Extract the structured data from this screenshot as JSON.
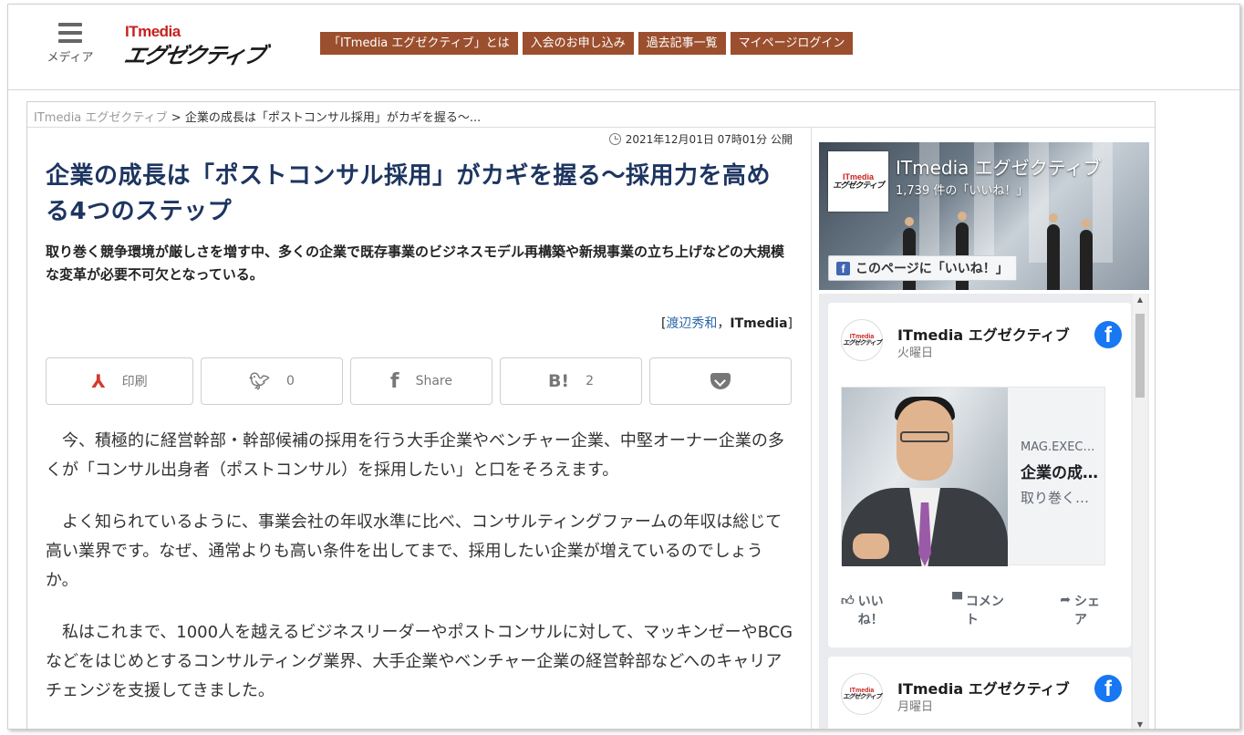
{
  "header": {
    "menu_label": "メディア",
    "logo_it": "ITmedia",
    "logo_ex": "エグゼクティブ",
    "nav": [
      {
        "label": "「ITmedia エグゼクティブ」とは"
      },
      {
        "label": "入会のお申し込み"
      },
      {
        "label": "過去記事一覧"
      },
      {
        "label": "マイページログイン"
      }
    ]
  },
  "breadcrumb": {
    "home": "ITmedia エグゼクティブ",
    "separator": ">",
    "current": "企業の成長は「ポストコンサル採用」がカギを握る～..."
  },
  "article": {
    "published": "2021年12月01日 07時01分 公開",
    "title": "企業の成長は「ポストコンサル採用」がカギを握る～採用力を高める4つのステップ",
    "lead": "取り巻く競争環境が厳しさを増す中、多くの企業で既存事業のビジネスモデル再構築や新規事業の立ち上げなどの大規模な変革が必要不可欠となっている。",
    "byline": {
      "open": "[",
      "author": "渡辺秀和",
      "sep": "，",
      "publisher": "ITmedia",
      "close": "]"
    },
    "share": {
      "print_label": "印刷",
      "twitter_count": "0",
      "facebook_label": "Share",
      "hatena_count": "2"
    },
    "paragraphs": [
      "今、積極的に経営幹部・幹部候補の採用を行う大手企業やベンチャー企業、中堅オーナー企業の多くが「コンサル出身者（ポストコンサル）を採用したい」と口をそろえます。",
      "よく知られているように、事業会社の年収水準に比べ、コンサルティングファームの年収は総じて高い業界です。なぜ、通常よりも高い条件を出してまで、採用したい企業が増えているのでしょうか。",
      "私はこれまで、1000人を越えるビジネスリーダーやポストコンサルに対して、マッキンゼーやBCGなどをはじめとするコンサルティング業界、大手企業やベンチャー企業の経営幹部などへのキャリアチェンジを支援してきました。"
    ]
  },
  "facebook": {
    "page_name": "ITmedia エグゼクティブ",
    "likes": "1,739 件の「いいね！」",
    "like_button": "このページに「いいね！」",
    "posts": [
      {
        "name": "ITmedia エグゼクティブ",
        "day": "火曜日",
        "link_domain": "MAG.EXECUTIVE.ITMEDIA.CO.JP",
        "link_title": "企業の成長は「ポストコンサル採用」がカギを握る",
        "link_desc": "取り巻く競争環境が厳しさを増す中",
        "actions": {
          "like": "いいね！",
          "comment": "コメント",
          "share": "シェア"
        }
      },
      {
        "name": "ITmedia エグゼクティブ",
        "day": "月曜日"
      }
    ]
  },
  "colors": {
    "nav_bg": "#9c4f2e",
    "title": "#1d3560",
    "logo_red": "#c8201e",
    "facebook_blue": "#1877f2"
  }
}
